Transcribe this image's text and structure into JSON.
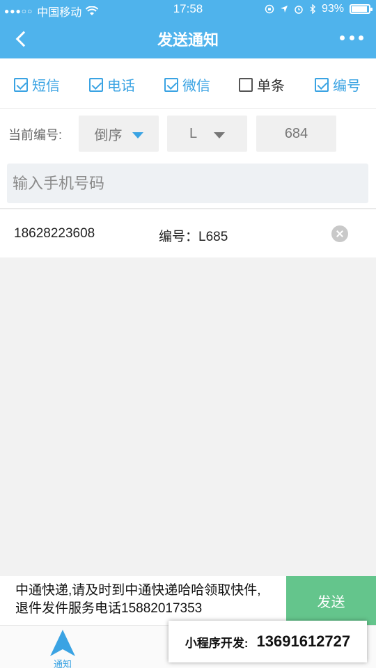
{
  "status_bar": {
    "carrier": "中国移动",
    "time": "17:58",
    "battery": "93%",
    "battery_level": 0.93
  },
  "nav": {
    "title": "发送通知"
  },
  "options": [
    {
      "label": "短信",
      "checked": true
    },
    {
      "label": "电话",
      "checked": true
    },
    {
      "label": "微信",
      "checked": true
    },
    {
      "label": "单条",
      "checked": false
    },
    {
      "label": "编号",
      "checked": true
    }
  ],
  "current_number": {
    "label": "当前编号:",
    "order": "倒序",
    "prefix": "L",
    "value": "684"
  },
  "phone_input": {
    "placeholder": "输入手机号码",
    "value": ""
  },
  "records": [
    {
      "phone": "18628223608",
      "code": "编号：L685"
    }
  ],
  "message": {
    "line1": "中通快递,请及时到中通快递哈哈领取快件,",
    "line2": "退件发件服务电话15882017353",
    "send_label": "发送"
  },
  "tabs": [
    {
      "label": "通知",
      "active": true
    }
  ],
  "ad": {
    "title": "小程序开发:",
    "number": "13691612727"
  },
  "colors": {
    "primary": "#4fb3ec",
    "accent": "#3aa3e3",
    "send": "#64c58c"
  }
}
